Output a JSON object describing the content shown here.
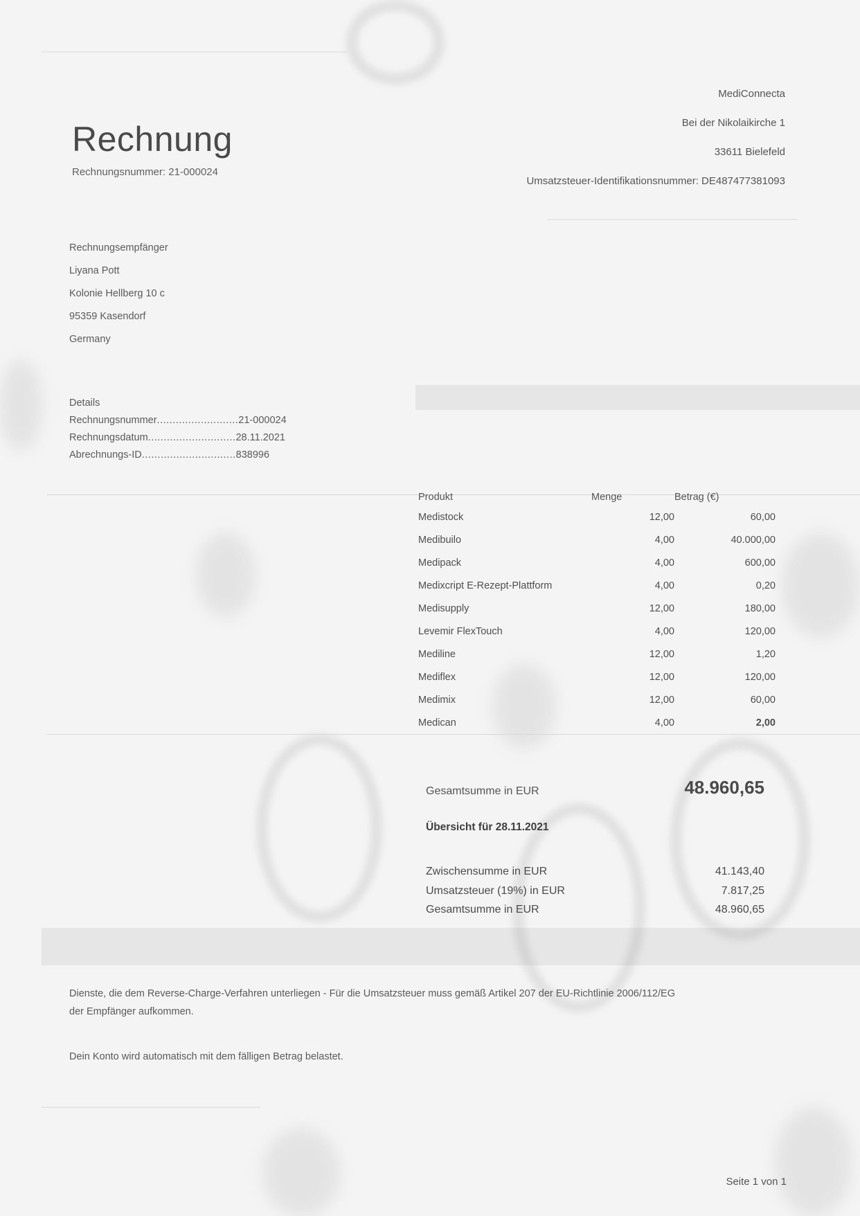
{
  "invoice": {
    "title": "Rechnung",
    "number_line": "Rechnungsnummer: 21-000024"
  },
  "seller": {
    "name": "MediConnecta",
    "street": "Bei der Nikolaikirche 1",
    "city": "33611 Bielefeld",
    "vat_line": "Umsatzsteuer-Identifikationsnummer: DE487477381093"
  },
  "recipient": {
    "heading": "Rechnungsempfänger",
    "name": "Liyana Pott",
    "street": "Kolonie Hellberg 10 c",
    "city": "95359 Kasendorf",
    "country": "Germany"
  },
  "details": {
    "heading": "Details",
    "rows": [
      {
        "label": "Rechnungsnummer",
        "dots": "..........................",
        "value": "21-000024"
      },
      {
        "label": "Rechnungsdatum",
        "dots": "............................",
        "value": "28.11.2021"
      },
      {
        "label": "Abrechnungs-ID",
        "dots": "..............................",
        "value": "838996"
      }
    ]
  },
  "items": {
    "headers": {
      "product": "Produkt",
      "qty": "Menge",
      "amount": "Betrag (€)"
    },
    "rows": [
      {
        "product": "Medistock",
        "qty": "12,00",
        "amount": "60,00"
      },
      {
        "product": "Medibuilo",
        "qty": "4,00",
        "amount": "40.000,00"
      },
      {
        "product": "Medipack",
        "qty": "4,00",
        "amount": "600,00"
      },
      {
        "product": "Medixcript E-Rezept-Plattform",
        "qty": "4,00",
        "amount": "0,20"
      },
      {
        "product": "Medisupply",
        "qty": "12,00",
        "amount": "180,00"
      },
      {
        "product": "Levemir FlexTouch",
        "qty": "4,00",
        "amount": "120,00"
      },
      {
        "product": "Mediline",
        "qty": "12,00",
        "amount": "1,20"
      },
      {
        "product": "Mediflex",
        "qty": "12,00",
        "amount": "120,00"
      },
      {
        "product": "Medimix",
        "qty": "12,00",
        "amount": "60,00"
      },
      {
        "product": "Medican",
        "qty": "4,00",
        "amount": "2,00"
      }
    ]
  },
  "totals": {
    "total_label": "Gesamtsumme in EUR",
    "total_value": "48.960,65",
    "overview": "Übersicht für 28.11.2021",
    "subtotal_label": "Zwischensumme in EUR",
    "subtotal_value": "41.143,40",
    "vat_label": "Umsatzsteuer (19%) in EUR",
    "vat_value": "7.817,25",
    "grand_label": "Gesamtsumme in EUR",
    "grand_value": "48.960,65"
  },
  "notes": {
    "reverse_charge_line1": "Dienste, die dem Reverse-Charge-Verfahren unterliegen - Für die Umsatzsteuer muss gemäß Artikel 207 der EU-Richtlinie 2006/112/EG",
    "reverse_charge_line2": "der Empfänger aufkommen.",
    "account": "Dein Konto wird automatisch mit dem fälligen Betrag belastet."
  },
  "footer": {
    "page": "Seite 1 von 1"
  }
}
